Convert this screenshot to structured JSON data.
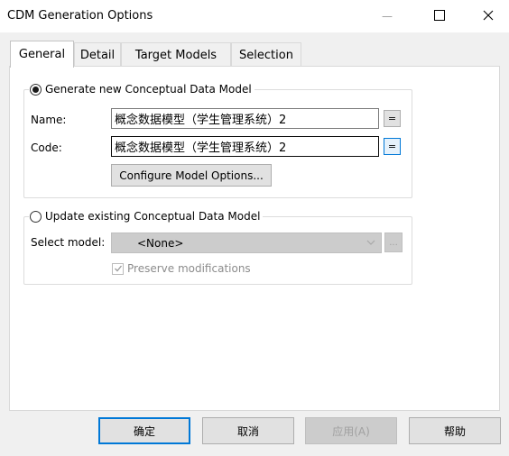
{
  "window": {
    "title": "CDM Generation Options",
    "minimize_glyph": "—",
    "maximize_glyph": "☐",
    "close_glyph": "✕"
  },
  "tabs": [
    {
      "label": "General",
      "active": true
    },
    {
      "label": "Detail",
      "active": false
    },
    {
      "label": "Target Models",
      "active": false
    },
    {
      "label": "Selection",
      "active": false
    }
  ],
  "generate_group": {
    "radio_label": "Generate new Conceptual Data Model",
    "selected": true,
    "name_label": "Name:",
    "name_value": "概念数据模型（学生管理系统）2",
    "code_label": "Code:",
    "code_value": "概念数据模型（学生管理系统）2",
    "equals_label": "=",
    "configure_button": "Configure Model Options..."
  },
  "update_group": {
    "radio_label": "Update existing Conceptual Data Model",
    "selected": false,
    "select_label": "Select model:",
    "select_value": "<None>",
    "browse_label": "...",
    "preserve_label": "Preserve modifications",
    "preserve_checked": true
  },
  "footer": {
    "ok": "确定",
    "cancel": "取消",
    "apply": "应用(A)",
    "help": "帮助"
  },
  "colors": {
    "focus_blue": "#0078d7",
    "disabled_gray": "#cccccc"
  }
}
